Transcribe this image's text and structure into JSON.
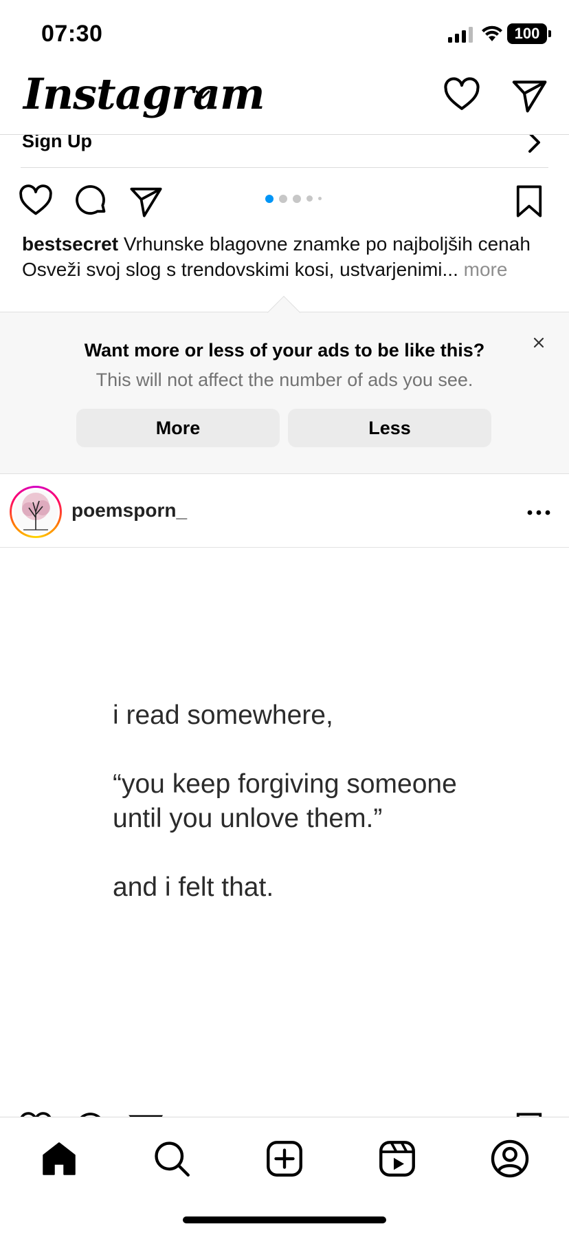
{
  "status_bar": {
    "time": "07:30",
    "battery": "100"
  },
  "header": {
    "logo": "Instagram"
  },
  "signup": {
    "label": "Sign Up"
  },
  "carousel": {
    "dot_count": 5,
    "active_index": 0
  },
  "caption": {
    "username": "bestsecret",
    "text": "Vrhunske blagovne znamke po najboljših cenah Osveži svoj slog s trendovskimi kosi, ustvarjenimi...",
    "more": "more"
  },
  "feedback": {
    "title": "Want more or less of your ads to be like this?",
    "subtitle": "This will not affect the number of ads you see.",
    "more_label": "More",
    "less_label": "Less"
  },
  "post": {
    "username": "poemsporn_",
    "quote": "i read somewhere,\n\n“you keep forgiving someone\nuntil you unlove them.”\n\nand i felt that."
  },
  "colors": {
    "accent": "#0095f6",
    "muted": "#737373",
    "panel": "#f7f7f7"
  }
}
